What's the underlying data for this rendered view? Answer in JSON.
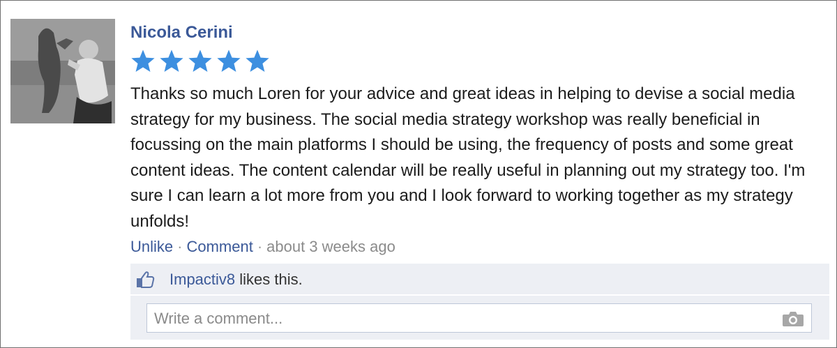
{
  "review": {
    "author_name": "Nicola Cerini",
    "rating_stars": 5,
    "text": "Thanks so much Loren for your advice and great ideas in helping to devise a social media strategy for my business. The social media strategy workshop was really beneficial in focussing on the main platforms I should be using, the frequency of posts and some great content ideas. The content calendar will be really useful in planning out my strategy too. I'm sure I can learn a lot more from you and I look forward to working together as my strategy unfolds!"
  },
  "actions": {
    "unlike_label": "Unlike",
    "separator": "·",
    "comment_label": "Comment",
    "timestamp": "about 3 weeks ago"
  },
  "likes": {
    "liker_name": "Impactiv8",
    "suffix": " likes this."
  },
  "comment_box": {
    "placeholder": "Write a comment..."
  },
  "colors": {
    "link": "#3b5998",
    "star": "#3d8fe0",
    "panel_bg": "#edeff4"
  },
  "icons": {
    "avatar": "profile-photo",
    "star": "star-icon",
    "like": "thumbs-up-icon",
    "camera": "camera-icon"
  }
}
